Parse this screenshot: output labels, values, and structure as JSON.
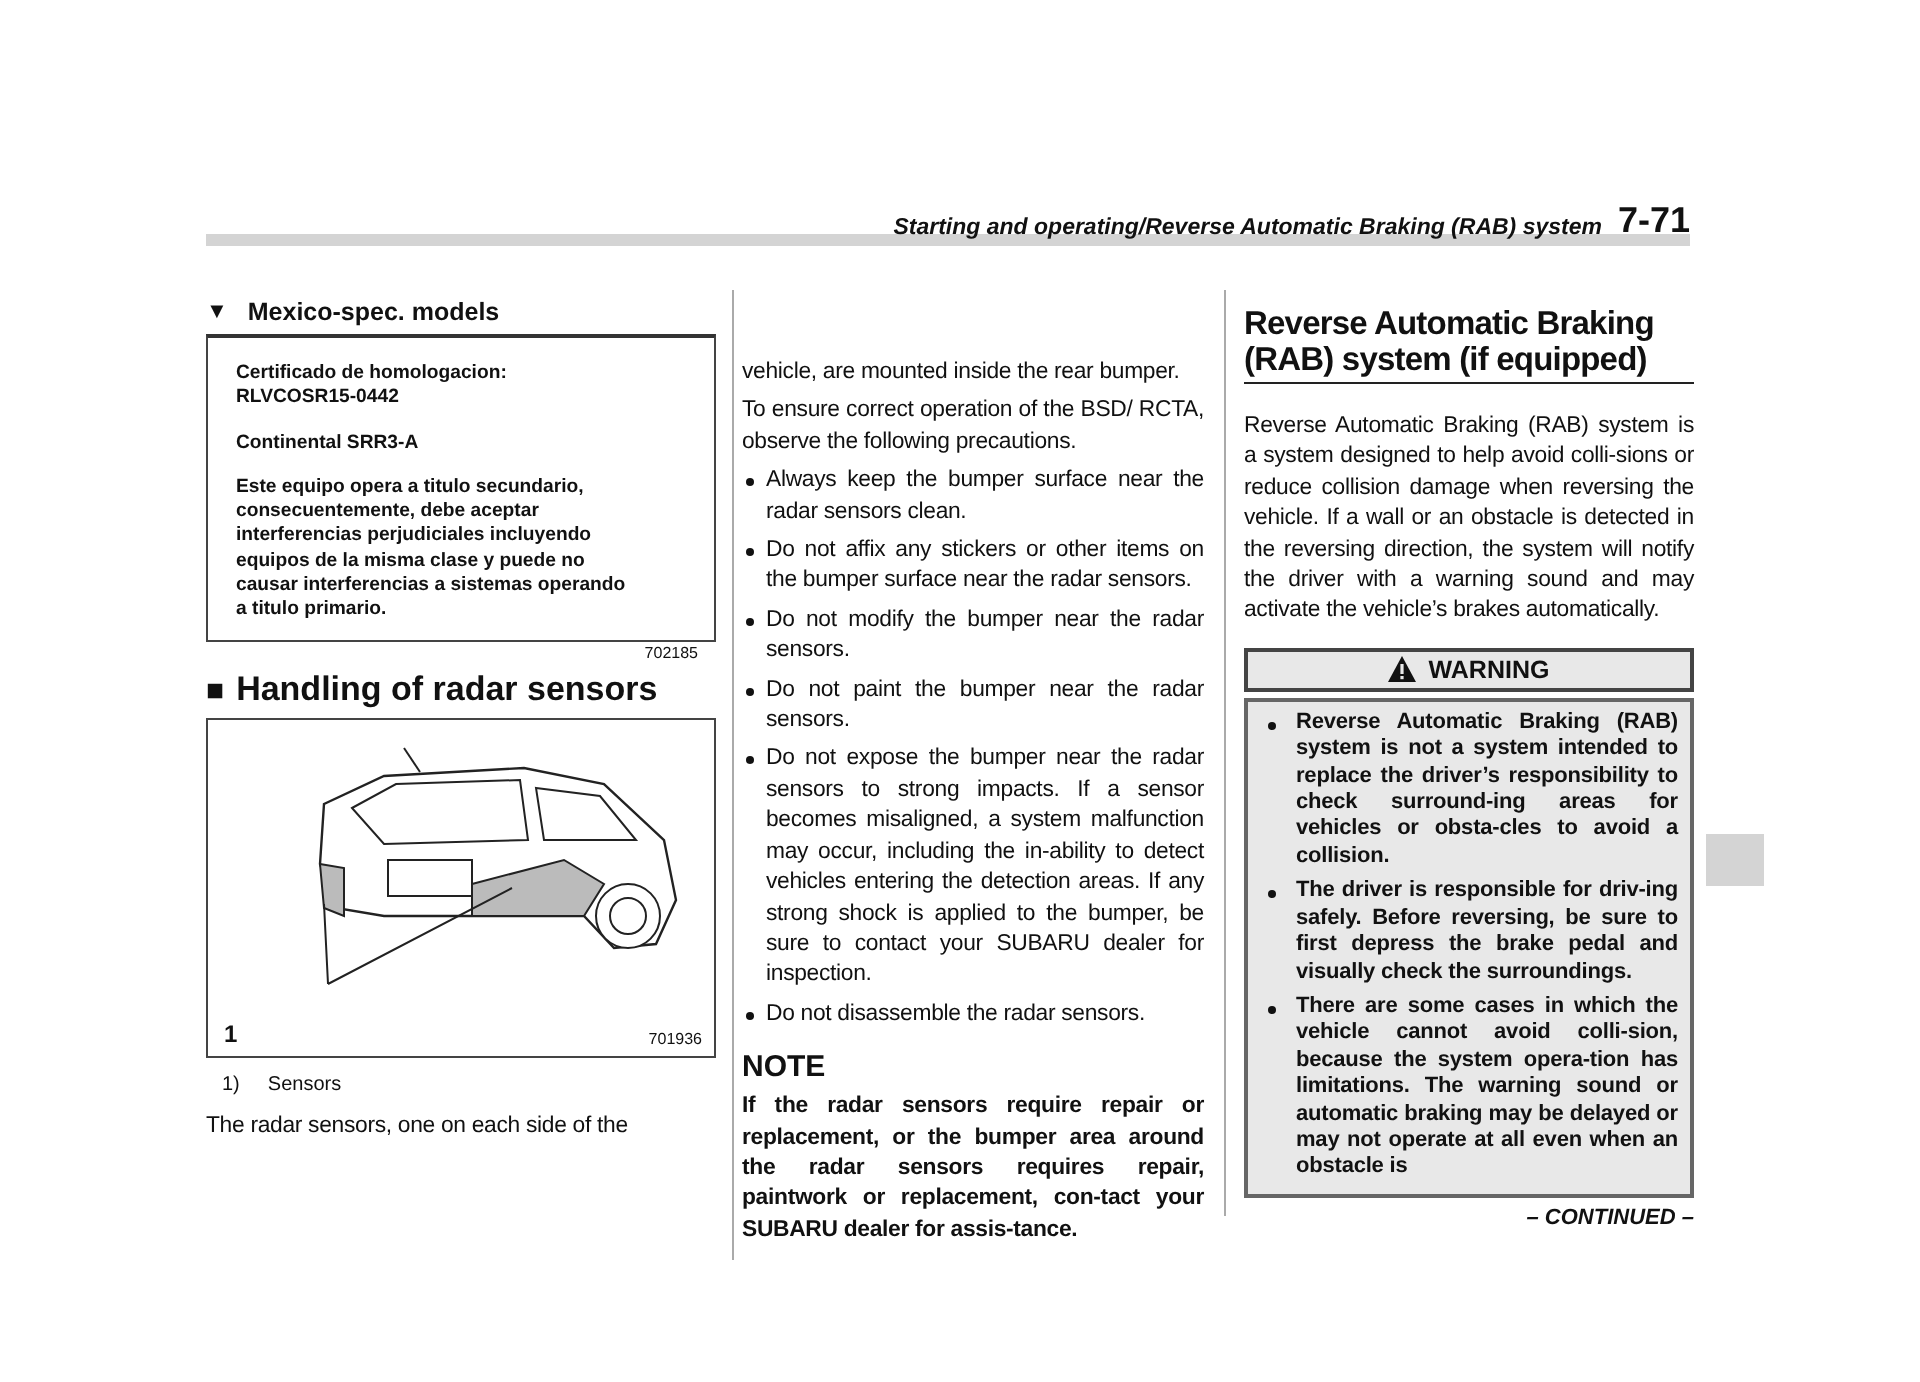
{
  "header": {
    "section_title": "Starting and operating/Reverse Automatic Braking (RAB) system",
    "page_number": "7-71"
  },
  "mexico_models": {
    "marker": "▼",
    "heading": "Mexico-spec. models",
    "certificate": [
      [
        "Certificado de homologacion:",
        "RLVCOSR15-0442"
      ],
      [
        "Continental SRR3-A"
      ],
      [
        "Este equipo opera a titulo secundario,",
        "consecuentemente, debe aceptar",
        "interferencias perjudiciales incluyendo",
        "equipos de la misma clase y puede no",
        "causar interferencias a sistemas operando",
        "a titulo primario."
      ]
    ],
    "figure_code": "702185"
  },
  "radar_section": {
    "marker": "■",
    "heading": "Handling of radar sensors",
    "figure": {
      "callout": "1",
      "figure_code": "701936"
    },
    "legend": [
      {
        "number": "1)",
        "label": "Sensors"
      }
    ],
    "column_1_text": "The radar sensors, one on each side of the",
    "column_2_blocks": [
      {
        "kind": "text",
        "text": "vehicle, are mounted inside the rear bumper."
      },
      {
        "kind": "text",
        "text": "To ensure correct operation of the BSD/ RCTA, observe the following precautions."
      },
      {
        "kind": "bullet",
        "text": "Always keep the bumper surface near the radar sensors clean."
      },
      {
        "kind": "bullet",
        "text": "Do not affix any stickers or other items on the bumper surface near the radar sensors."
      },
      {
        "kind": "bullet",
        "text": "Do not modify the bumper near the radar sensors."
      },
      {
        "kind": "bullet",
        "text": "Do not paint the bumper near the radar sensors."
      },
      {
        "kind": "bullet",
        "text": "Do not expose the bumper near the radar sensors to strong impacts. If a sensor becomes misaligned, a system malfunction may occur, including the in-ability to detect vehicles entering the detection areas. If any strong shock is applied to the bumper, be sure to contact your SUBARU dealer for inspection."
      },
      {
        "kind": "bullet",
        "text": "Do not disassemble the radar sensors."
      }
    ],
    "note": {
      "heading": "NOTE",
      "text": "If the radar sensors require repair or replacement, or the bumper area around the radar sensors requires repair, paintwork or replacement, con-tact your SUBARU dealer for assis-tance."
    }
  },
  "rab_section": {
    "heading": "Reverse Automatic Braking (RAB) system (if equipped)",
    "intro": "Reverse Automatic Braking (RAB) system is a system designed to help avoid colli-sions or reduce collision damage when reversing the vehicle. If a wall or an obstacle is detected in the reversing direction, the system will notify the driver with a warning sound and may activate the vehicle’s brakes automatically.",
    "warning": {
      "heading": "WARNING",
      "bullets": [
        "Reverse Automatic Braking (RAB) system is not a system intended to replace the driver’s responsibility to check surround-ing areas for vehicles or obsta-cles to avoid a collision.",
        "The driver is responsible for driv-ing safely. Before reversing, be sure to first depress the brake pedal and visually check the surroundings.",
        "There are some cases in which the vehicle cannot avoid colli-sion, because the system opera-tion has limitations. The warning sound or automatic braking may be delayed or may not operate at all even when an obstacle is"
      ]
    }
  },
  "footer": {
    "continued": "– CONTINUED –"
  }
}
